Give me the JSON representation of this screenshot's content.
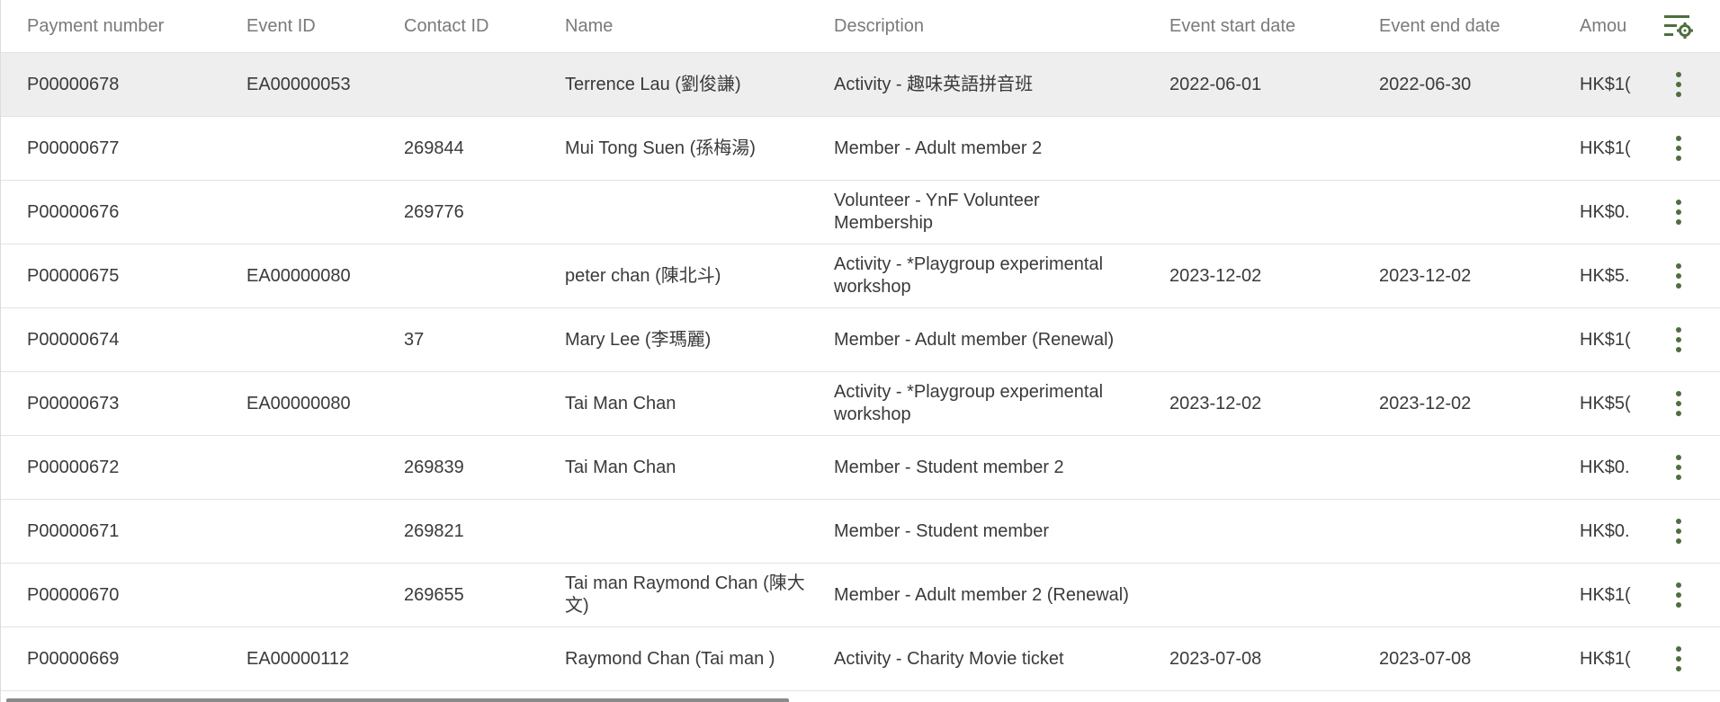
{
  "columns": {
    "payment_number": "Payment number",
    "event_id": "Event ID",
    "contact_id": "Contact ID",
    "name": "Name",
    "description": "Description",
    "event_start_date": "Event start date",
    "event_end_date": "Event end date",
    "amount": "Amou"
  },
  "icons": {
    "column_settings": "column-settings-icon",
    "row_menu": "more-vertical-icon",
    "accent_color": "#4f6e3f"
  },
  "rows": [
    {
      "payment_number": "P00000678",
      "event_id": "EA00000053",
      "contact_id": "",
      "name": "Terrence Lau (劉俊謙)",
      "description": "Activity - 趣味英語拼音班",
      "start": "2022-06-01",
      "end": "2022-06-30",
      "amount": "HK$1("
    },
    {
      "payment_number": "P00000677",
      "event_id": "",
      "contact_id": "269844",
      "name": "Mui Tong Suen (孫梅湯)",
      "description": "Member - Adult member 2",
      "start": "",
      "end": "",
      "amount": "HK$1("
    },
    {
      "payment_number": "P00000676",
      "event_id": "",
      "contact_id": "269776",
      "name": "",
      "description": "Volunteer - YnF Volunteer Membership",
      "start": "",
      "end": "",
      "amount": "HK$0."
    },
    {
      "payment_number": "P00000675",
      "event_id": "EA00000080",
      "contact_id": "",
      "name": "peter chan (陳北斗)",
      "description": "Activity - *Playgroup experimental workshop",
      "start": "2023-12-02",
      "end": "2023-12-02",
      "amount": "HK$5."
    },
    {
      "payment_number": "P00000674",
      "event_id": "",
      "contact_id": "37",
      "name": "Mary Lee (李瑪麗)",
      "description": "Member - Adult member (Renewal)",
      "start": "",
      "end": "",
      "amount": "HK$1("
    },
    {
      "payment_number": "P00000673",
      "event_id": "EA00000080",
      "contact_id": "",
      "name": "Tai Man Chan",
      "description": "Activity - *Playgroup experimental workshop",
      "start": "2023-12-02",
      "end": "2023-12-02",
      "amount": "HK$5("
    },
    {
      "payment_number": "P00000672",
      "event_id": "",
      "contact_id": "269839",
      "name": "Tai Man Chan",
      "description": "Member - Student member 2",
      "start": "",
      "end": "",
      "amount": "HK$0."
    },
    {
      "payment_number": "P00000671",
      "event_id": "",
      "contact_id": "269821",
      "name": "",
      "description": "Member - Student member",
      "start": "",
      "end": "",
      "amount": "HK$0."
    },
    {
      "payment_number": "P00000670",
      "event_id": "",
      "contact_id": "269655",
      "name": "Tai man Raymond Chan (陳大文)",
      "description": "Member - Adult member 2 (Renewal)",
      "start": "",
      "end": "",
      "amount": "HK$1("
    },
    {
      "payment_number": "P00000669",
      "event_id": "EA00000112",
      "contact_id": "",
      "name": "Raymond Chan (Tai man )",
      "description": "Activity - Charity Movie ticket",
      "start": "2023-07-08",
      "end": "2023-07-08",
      "amount": "HK$1("
    }
  ]
}
